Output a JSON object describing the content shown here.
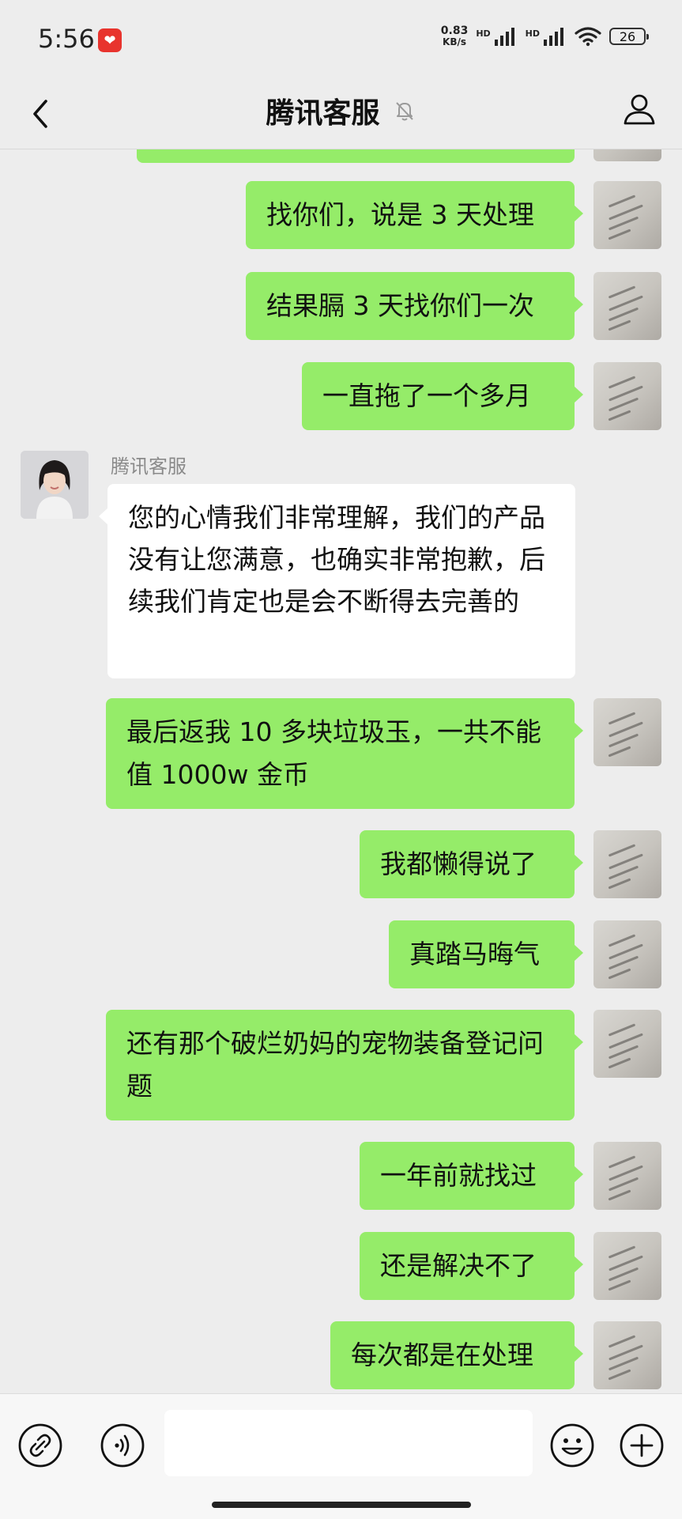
{
  "status_bar": {
    "time": "5:56",
    "app_badge_icon": "heart-app-icon",
    "net_speed_value": "0.83",
    "net_speed_unit": "KB/s",
    "hd_label_1": "HD",
    "hd_label_2": "HD",
    "battery": "26"
  },
  "header": {
    "title": "腾讯客服",
    "muted": true
  },
  "chat": {
    "agent_name": "腾讯客服",
    "messages": [
      {
        "side": "right",
        "text": ""
      },
      {
        "side": "right",
        "text": "找你们，说是 3 天处理"
      },
      {
        "side": "right",
        "text": "结果膈 3 天找你们一次"
      },
      {
        "side": "right",
        "text": "一直拖了一个多月"
      },
      {
        "side": "left",
        "text": "您的心情我们非常理解，我们的产品没有让您满意，也确实非常抱歉，后续我们肯定也是会不断得去完善的"
      },
      {
        "side": "right",
        "text": "最后返我 10 多块垃圾玉，一共不能值 1000w 金币"
      },
      {
        "side": "right",
        "text": "我都懒得说了"
      },
      {
        "side": "right",
        "text": "真踏马晦气"
      },
      {
        "side": "right",
        "text": "还有那个破烂奶妈的宠物装备登记问题"
      },
      {
        "side": "right",
        "text": "一年前就找过"
      },
      {
        "side": "right",
        "text": "还是解决不了"
      },
      {
        "side": "right",
        "text": "每次都是在处理"
      }
    ]
  },
  "input_bar": {
    "input_value": "",
    "icons": [
      "link-icon",
      "voice-icon",
      "emoji-icon",
      "plus-icon"
    ]
  },
  "colors": {
    "bubble_self": "#95ec69",
    "bubble_other": "#ffffff",
    "background": "#ededed"
  }
}
